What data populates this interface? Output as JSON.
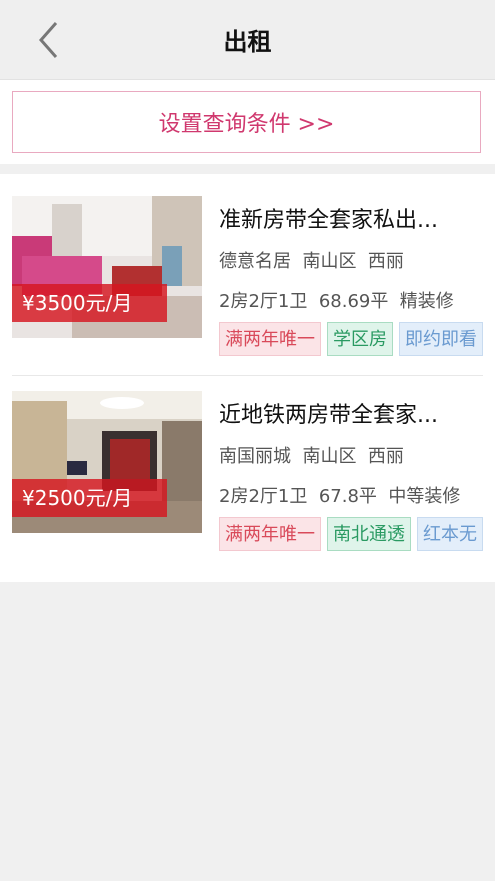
{
  "header": {
    "title": "出租"
  },
  "filter": {
    "label": "设置查询条件 >>"
  },
  "listings": [
    {
      "price": "¥3500元/月",
      "title": "准新房带全套家私出...",
      "community": "德意名居",
      "district": "南山区",
      "area": "西丽",
      "layout": "2房2厅1卫",
      "size": "68.69平",
      "decoration": "精装修",
      "tags": [
        {
          "label": "满两年唯一",
          "color": "red"
        },
        {
          "label": "学区房",
          "color": "green"
        },
        {
          "label": "即约即看",
          "color": "blue"
        }
      ]
    },
    {
      "price": "¥2500元/月",
      "title": "近地铁两房带全套家...",
      "community": "南国丽城",
      "district": "南山区",
      "area": "西丽",
      "layout": "2房2厅1卫",
      "size": "67.8平",
      "decoration": "中等装修",
      "tags": [
        {
          "label": "满两年唯一",
          "color": "red"
        },
        {
          "label": "南北通透",
          "color": "green"
        },
        {
          "label": "红本无",
          "color": "blue"
        }
      ]
    }
  ],
  "colors": {
    "accent": "#d0386e",
    "price_bg": "#d61620"
  },
  "icons": {
    "back": "chevron-left-icon"
  }
}
